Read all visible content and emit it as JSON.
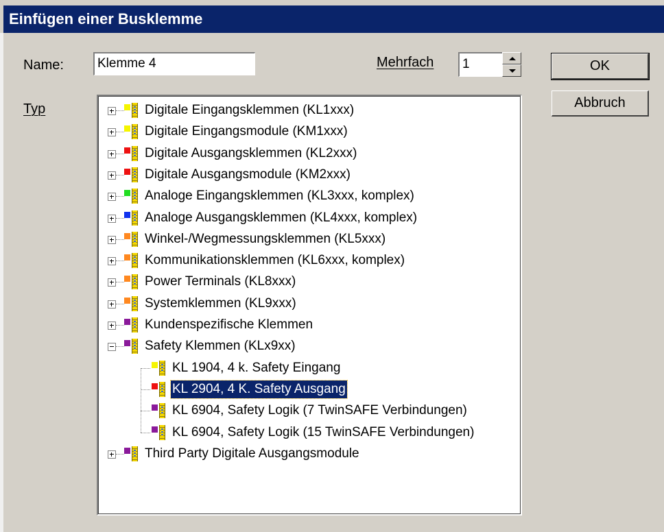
{
  "dialog": {
    "title": "Einfügen einer Busklemme",
    "name_label": "Name:",
    "name_value": "Klemme 4",
    "mehrfach_label": "Mehrfach",
    "mehrfach_value": "1",
    "typ_label": "Typ",
    "ok_label": "OK",
    "cancel_label": "Abbruch"
  },
  "tree": {
    "items": [
      {
        "label": "Digitale Eingangsklemmen (KL1xxx)",
        "color": "#f5f500"
      },
      {
        "label": "Digitale Eingangsmodule (KM1xxx)",
        "color": "#f5f500"
      },
      {
        "label": "Digitale Ausgangsklemmen (KL2xxx)",
        "color": "#ee1111"
      },
      {
        "label": "Digitale Ausgangsmodule (KM2xxx)",
        "color": "#ee1111"
      },
      {
        "label": "Analoge Eingangsklemmen (KL3xxx, komplex)",
        "color": "#22dd22"
      },
      {
        "label": "Analoge Ausgangsklemmen (KL4xxx, komplex)",
        "color": "#1133ee"
      },
      {
        "label": "Winkel-/Wegmessungsklemmen (KL5xxx)",
        "color": "#ff8820"
      },
      {
        "label": "Kommunikationsklemmen (KL6xxx, komplex)",
        "color": "#ff8820"
      },
      {
        "label": "Power Terminals (KL8xxx)",
        "color": "#ff8820"
      },
      {
        "label": "Systemklemmen (KL9xxx)",
        "color": "#ff8820"
      },
      {
        "label": "Kundenspezifische Klemmen",
        "color": "#8a1a9a"
      },
      {
        "label": "Safety Klemmen (KLx9xx)",
        "color": "#8a1a9a"
      },
      {
        "label": "KL 1904, 4 k. Safety Eingang",
        "color": "#f5f500"
      },
      {
        "label": "KL 2904, 4 K. Safety Ausgang",
        "color": "#ee1111"
      },
      {
        "label": "KL 6904, Safety Logik (7 TwinSAFE Verbindungen)",
        "color": "#8a1a9a"
      },
      {
        "label": "KL 6904, Safety Logik (15 TwinSAFE Verbindungen)",
        "color": "#8a1a9a"
      },
      {
        "label": "Third Party Digitale Ausgangsmodule",
        "color": "#8a1a9a"
      }
    ]
  }
}
